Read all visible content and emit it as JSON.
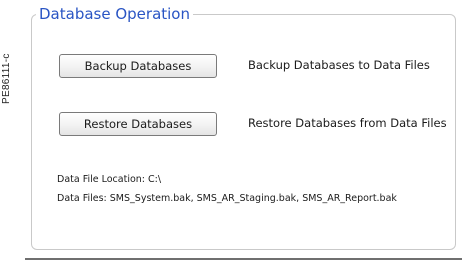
{
  "figure_code": "PE86111-c",
  "group": {
    "title": "Database Operation"
  },
  "backup": {
    "button_label": "Backup Databases",
    "description": "Backup Databases to Data Files"
  },
  "restore": {
    "button_label": "Restore Databases",
    "description": "Restore Databases from Data Files"
  },
  "info": {
    "location_label": "Data File Location:",
    "location_value": "C:\\",
    "files_label": "Data Files:",
    "files_value": "SMS_System.bak, SMS_AR_Staging.bak, SMS_AR_Report.bak"
  },
  "colors": {
    "title": "#2a55c4",
    "frame": "#c9c9c9",
    "text": "#1b1b1b"
  }
}
